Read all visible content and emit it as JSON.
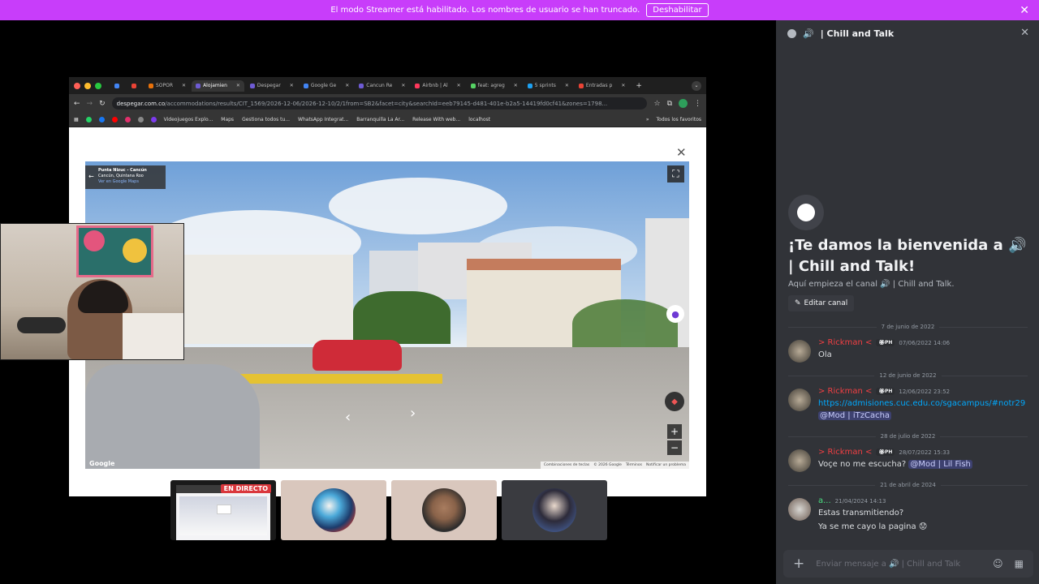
{
  "banner": {
    "text": "El modo Streamer está habilitado. Los nombres de usuario se han truncado.",
    "button": "Deshabilitar"
  },
  "browser": {
    "tabs": [
      {
        "label": "",
        "color": "#4285f4"
      },
      {
        "label": "",
        "color": "#ea4335"
      },
      {
        "label": "SOPOR",
        "color": "#e8710a"
      },
      {
        "label": "Alojamien",
        "color": "#6e5bd4",
        "active": true
      },
      {
        "label": "Despegar",
        "color": "#6e5bd4"
      },
      {
        "label": "Google Ge",
        "color": "#4285f4"
      },
      {
        "label": "Cancun Re",
        "color": "#6e5bd4"
      },
      {
        "label": "Airbnb | Al",
        "color": "#ff385c"
      },
      {
        "label": "feat: agreg",
        "color": "#56d364"
      },
      {
        "label": "5 sprints",
        "color": "#1da1f2"
      },
      {
        "label": "Entradas p",
        "color": "#ea4335"
      }
    ],
    "url_host": "despegar.com.co",
    "url_rest": "/accommodations/results/CIT_1569/2026-12-06/2026-12-10/2/1from=SB2&facet=city&searchId=eeb79145-d481-401e-b2a5-14419fd0cf41&zones=1798...",
    "bookmarks": [
      "Videojuegos Explo...",
      "Maps",
      "Gestiona todos tu...",
      "WhatsApp Integrat...",
      "Barranquilla La Ar...",
      "Release With web...",
      "localhost"
    ],
    "all_bookmarks": "Todos los favoritos"
  },
  "streetview": {
    "place_title": "Punta Nizuc - Cancún",
    "place_subtitle": "Cancún, Quintana Roo",
    "place_link": "Ver en Google Maps",
    "footer": [
      "Combinaciones de teclas",
      "© 2026 Google",
      "Términos",
      "Notificar un problema"
    ],
    "logo": "Google"
  },
  "tiles": {
    "live_label": "EN DIRECTO"
  },
  "panel": {
    "channel_name": "| Chill and Talk",
    "welcome_title": "¡Te damos la bienvenida a 🔊 | Chill and Talk!",
    "welcome_sub": "Aquí empieza el canal 🔊 | Chill and Talk.",
    "edit_button": "Editar canal",
    "messages": [
      {
        "date": "7 de junio de 2022",
        "author": "> Rickman <",
        "tag": "🏵PH",
        "time": "07/06/2022 14:06",
        "lines": [
          "Ola"
        ]
      },
      {
        "date": "12 de junio de 2022",
        "author": "> Rickman <",
        "tag": "🏵PH",
        "time": "12/06/2022 23:52",
        "link": "https://admisiones.cuc.edu.co/sgacampus/#notr29",
        "mention": "@Mod | iTzCacha"
      },
      {
        "date": "28 de julio de 2022",
        "author": "> Rickman <",
        "tag": "🏵PH",
        "time": "28/07/2022 15:33",
        "text": "Voçe no me escucha?",
        "mention": "@Mod | Lil Fish"
      },
      {
        "date": "21 de abril de 2024",
        "author": "a...",
        "time": "21/04/2024 14:13",
        "lines": [
          "Estas transmitiendo?",
          "Ya se me cayo la pagina 😟"
        ]
      }
    ],
    "composer_placeholder": "Enviar mensaje a 🔊 | Chill and Talk"
  }
}
